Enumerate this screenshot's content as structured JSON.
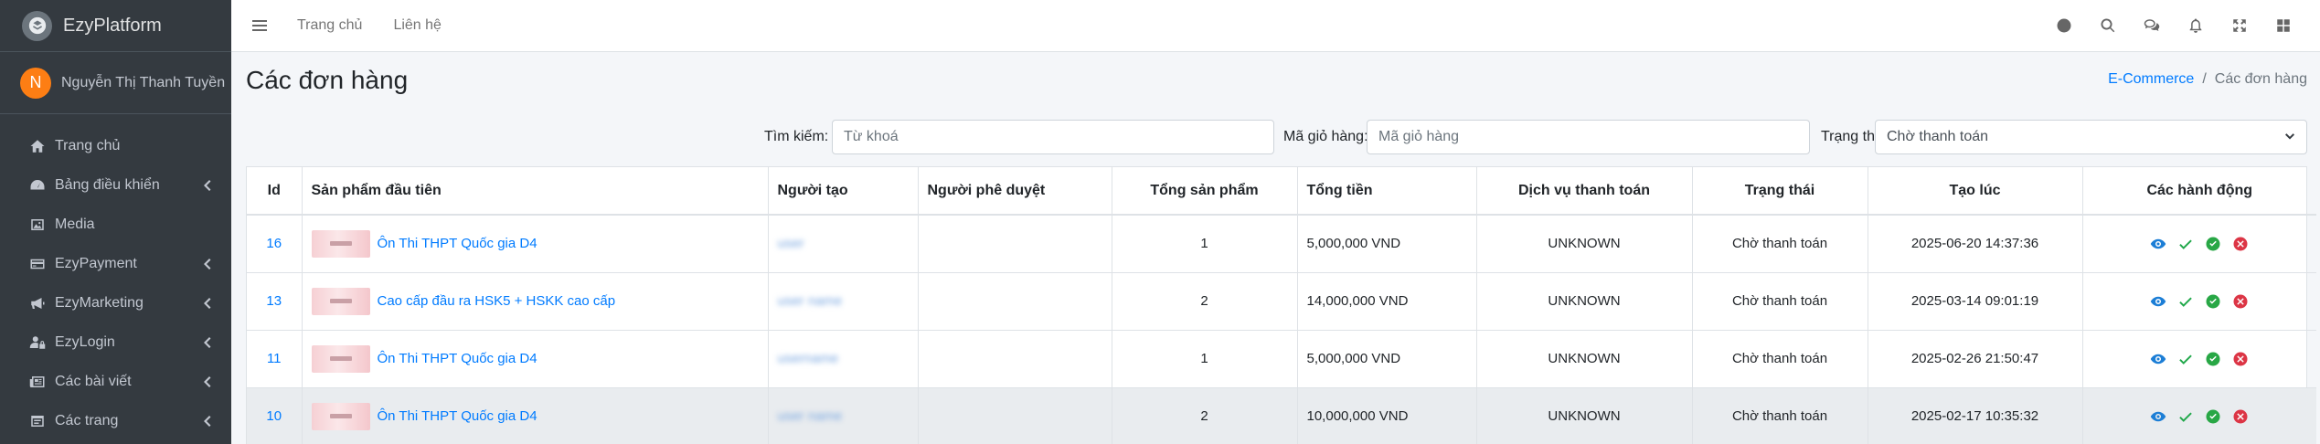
{
  "brand": {
    "name": "EzyPlatform"
  },
  "user": {
    "initial": "N",
    "name": "Nguyễn Thị Thanh Tuyền"
  },
  "sidebar": {
    "items": [
      {
        "label": "Trang chủ",
        "icon": "home-icon",
        "has_children": false
      },
      {
        "label": "Bảng điều khiển",
        "icon": "dashboard-icon",
        "has_children": true
      },
      {
        "label": "Media",
        "icon": "image-icon",
        "has_children": false
      },
      {
        "label": "EzyPayment",
        "icon": "payment-card-icon",
        "has_children": true
      },
      {
        "label": "EzyMarketing",
        "icon": "megaphone-icon",
        "has_children": true
      },
      {
        "label": "EzyLogin",
        "icon": "user-lock-icon",
        "has_children": true
      },
      {
        "label": "Các bài viết",
        "icon": "newspaper-icon",
        "has_children": true
      },
      {
        "label": "Các trang",
        "icon": "pages-icon",
        "has_children": true
      }
    ]
  },
  "topbar": {
    "links": [
      "Trang chủ",
      "Liên hệ"
    ],
    "icons": [
      "globe-icon",
      "search-icon",
      "comments-icon",
      "bell-icon",
      "fullscreen-icon",
      "apps-grid-icon"
    ]
  },
  "page": {
    "title": "Các đơn hàng",
    "breadcrumb": {
      "parent": "E-Commerce",
      "current": "Các đơn hàng"
    }
  },
  "filters": {
    "search_label": "Tìm kiếm:",
    "search_placeholder": "Từ khoá",
    "cart_label": "Mã giỏ hàng:",
    "cart_placeholder": "Mã giỏ hàng",
    "status_label": "Trạng thái:",
    "status_value": "Chờ thanh toán"
  },
  "table": {
    "headers": [
      "Id",
      "Sản phẩm đầu tiên",
      "Người tạo",
      "Người phê duyệt",
      "Tổng sản phẩm",
      "Tổng tiền",
      "Dịch vụ thanh toán",
      "Trạng thái",
      "Tạo lúc",
      "Các hành động"
    ],
    "rows": [
      {
        "id": "16",
        "product": "Ôn Thi THPT Quốc gia D4",
        "creator": "user",
        "approver": "",
        "total_items": "1",
        "total_price": "5,000,000 VND",
        "payment_service": "UNKNOWN",
        "status": "Chờ thanh toán",
        "created_at": "2025-06-20 14:37:36"
      },
      {
        "id": "13",
        "product": "Cao cấp đầu ra HSK5 + HSKK cao cấp",
        "creator": "user name",
        "approver": "",
        "total_items": "2",
        "total_price": "14,000,000 VND",
        "payment_service": "UNKNOWN",
        "status": "Chờ thanh toán",
        "created_at": "2025-03-14 09:01:19"
      },
      {
        "id": "11",
        "product": "Ôn Thi THPT Quốc gia D4",
        "creator": "username",
        "approver": "",
        "total_items": "1",
        "total_price": "5,000,000 VND",
        "payment_service": "UNKNOWN",
        "status": "Chờ thanh toán",
        "created_at": "2025-02-26 21:50:47"
      },
      {
        "id": "10",
        "product": "Ôn Thi THPT Quốc gia D4",
        "creator": "user name",
        "approver": "",
        "total_items": "2",
        "total_price": "10,000,000 VND",
        "payment_service": "UNKNOWN",
        "status": "Chờ thanh toán",
        "created_at": "2025-02-17 10:35:32"
      }
    ],
    "action_icons": [
      "view-eye-icon",
      "approve-check-icon",
      "complete-circle-check-icon",
      "cancel-circle-x-icon"
    ]
  },
  "colors": {
    "sidebar_bg": "#343a40",
    "link": "#007bff",
    "avatar": "#fd7e14",
    "view": "#1c7ed6",
    "approve": "#20a84a",
    "complete": "#28a745",
    "cancel": "#dc3545"
  }
}
